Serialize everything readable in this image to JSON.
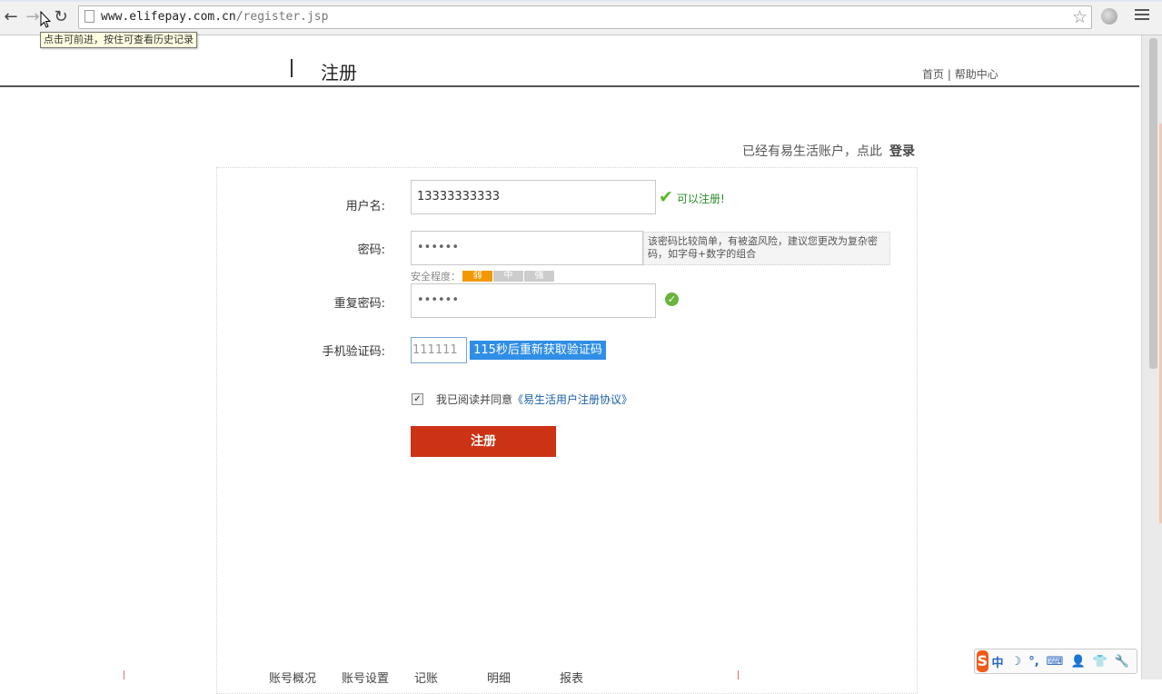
{
  "browser": {
    "url_host": "www.elifepay.com.cn",
    "url_path": "/register.jsp",
    "tooltip": "点击可前进，按住可查看历史记录"
  },
  "header": {
    "title": "注册",
    "link_home": "首页",
    "separator": "|",
    "link_help": "帮助中心"
  },
  "login_hint": {
    "text": "已经有易生活账户，点此",
    "login_label": "登录"
  },
  "form": {
    "username_label": "用户名:",
    "username_value": "13333333333",
    "username_status": "可以注册!",
    "password_label": "密码:",
    "password_value": "••••••",
    "password_tip": "该密码比较简单，有被盗风险，建议您更改为复杂密码，如字母+数字的组合",
    "strength_label": "安全程度：",
    "strength_levels": [
      "弱",
      "中",
      "强"
    ],
    "strength_level_current": "弱",
    "repeat_label": "重复密码:",
    "repeat_value": "••••••",
    "sms_label": "手机验证码:",
    "sms_value": "111111",
    "sms_button": "115秒后重新获取验证码",
    "agree_text": "我已阅读并同意",
    "agree_link": "《易生活用户注册协议》",
    "agree_checked": true,
    "submit_label": "注册"
  },
  "bottom_nav": [
    "账号概况",
    "账号设置",
    "记账",
    "明细",
    "报表"
  ],
  "ime": {
    "logo": "S",
    "mode": "中",
    "items": [
      "☽",
      "°,",
      "⌨",
      "👤",
      "👕",
      "🔧"
    ]
  },
  "colors": {
    "submit": "#cc3214",
    "sms_button": "#2f8ee6",
    "strength_weak": "#f39800",
    "success": "#5cb82c"
  }
}
